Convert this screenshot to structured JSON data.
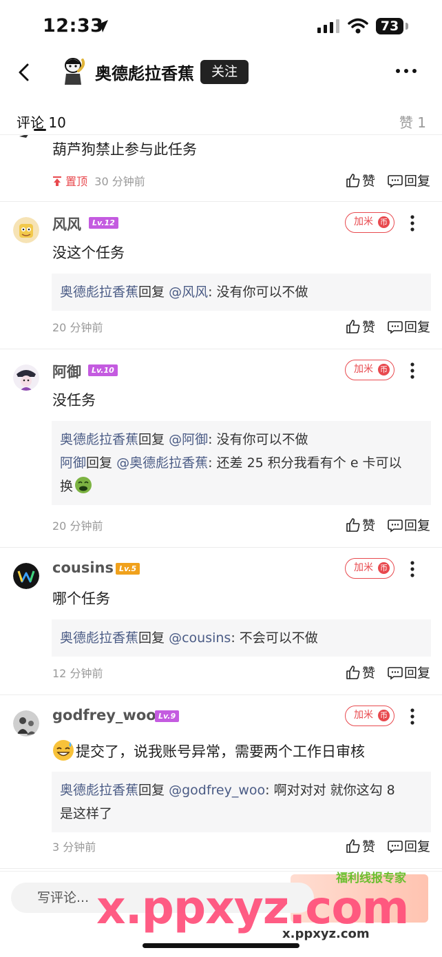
{
  "status_bar": {
    "time": "12:33",
    "battery": "73"
  },
  "header": {
    "author": "奥德彪拉香蕉",
    "follow_label": "关注"
  },
  "tabs": {
    "comments": "评论 10",
    "likes": "赞 1"
  },
  "action_labels": {
    "like": "赞",
    "reply": "回复",
    "jiami": "加米",
    "coin": "币"
  },
  "pinned": {
    "text": "葫芦狗禁止参与此任务",
    "tag": "置顶",
    "time": "30 分钟前"
  },
  "comments": [
    {
      "user": "风风",
      "level": "Lv.12",
      "level_color": "#c45be0",
      "text": "没这个任务",
      "replies": [
        {
          "from": "奥德彪拉香蕉",
          "verb": "回复",
          "to": "@风风",
          "text": ": 没有你可以不做"
        }
      ],
      "time": "20 分钟前"
    },
    {
      "user": "阿御",
      "level": "Lv.10",
      "level_color": "#c45be0",
      "text": "没任务",
      "replies": [
        {
          "from": "奥德彪拉香蕉",
          "verb": "回复",
          "to": "@阿御",
          "text": ": 没有你可以不做"
        },
        {
          "from": "阿御",
          "verb": "回复",
          "to": "@奥德彪拉香蕉",
          "text": ":  还差 25 积分我看有个 e 卡可以",
          "text2": "换"
        }
      ],
      "time": "20 分钟前"
    },
    {
      "user": "cousins",
      "level": "Lv.5",
      "level_color": "#f0a11c",
      "text": "哪个任务",
      "replies": [
        {
          "from": "奥德彪拉香蕉",
          "verb": "回复",
          "to": "@cousins",
          "text": ": 不会可以不做"
        }
      ],
      "time": "12 分钟前"
    },
    {
      "user": "godfrey_woo",
      "level": "Lv.9",
      "level_color": "#c45be0",
      "text": "提交了，说我账号异常，需要两个工作日审核",
      "replies": [
        {
          "from": "奥德彪拉香蕉",
          "verb": "回复",
          "to": "@godfrey_woo",
          "text": ":  啊对对对  就你这勾 8",
          "text2": "是这样了"
        }
      ],
      "time": "3 分钟前"
    }
  ],
  "bottom_bar": {
    "input_placeholder": "写评论...",
    "promo_label": "福利线报专家",
    "watermark": "x.ppxyz.com",
    "watermark_small": "x.ppxyz.com"
  }
}
